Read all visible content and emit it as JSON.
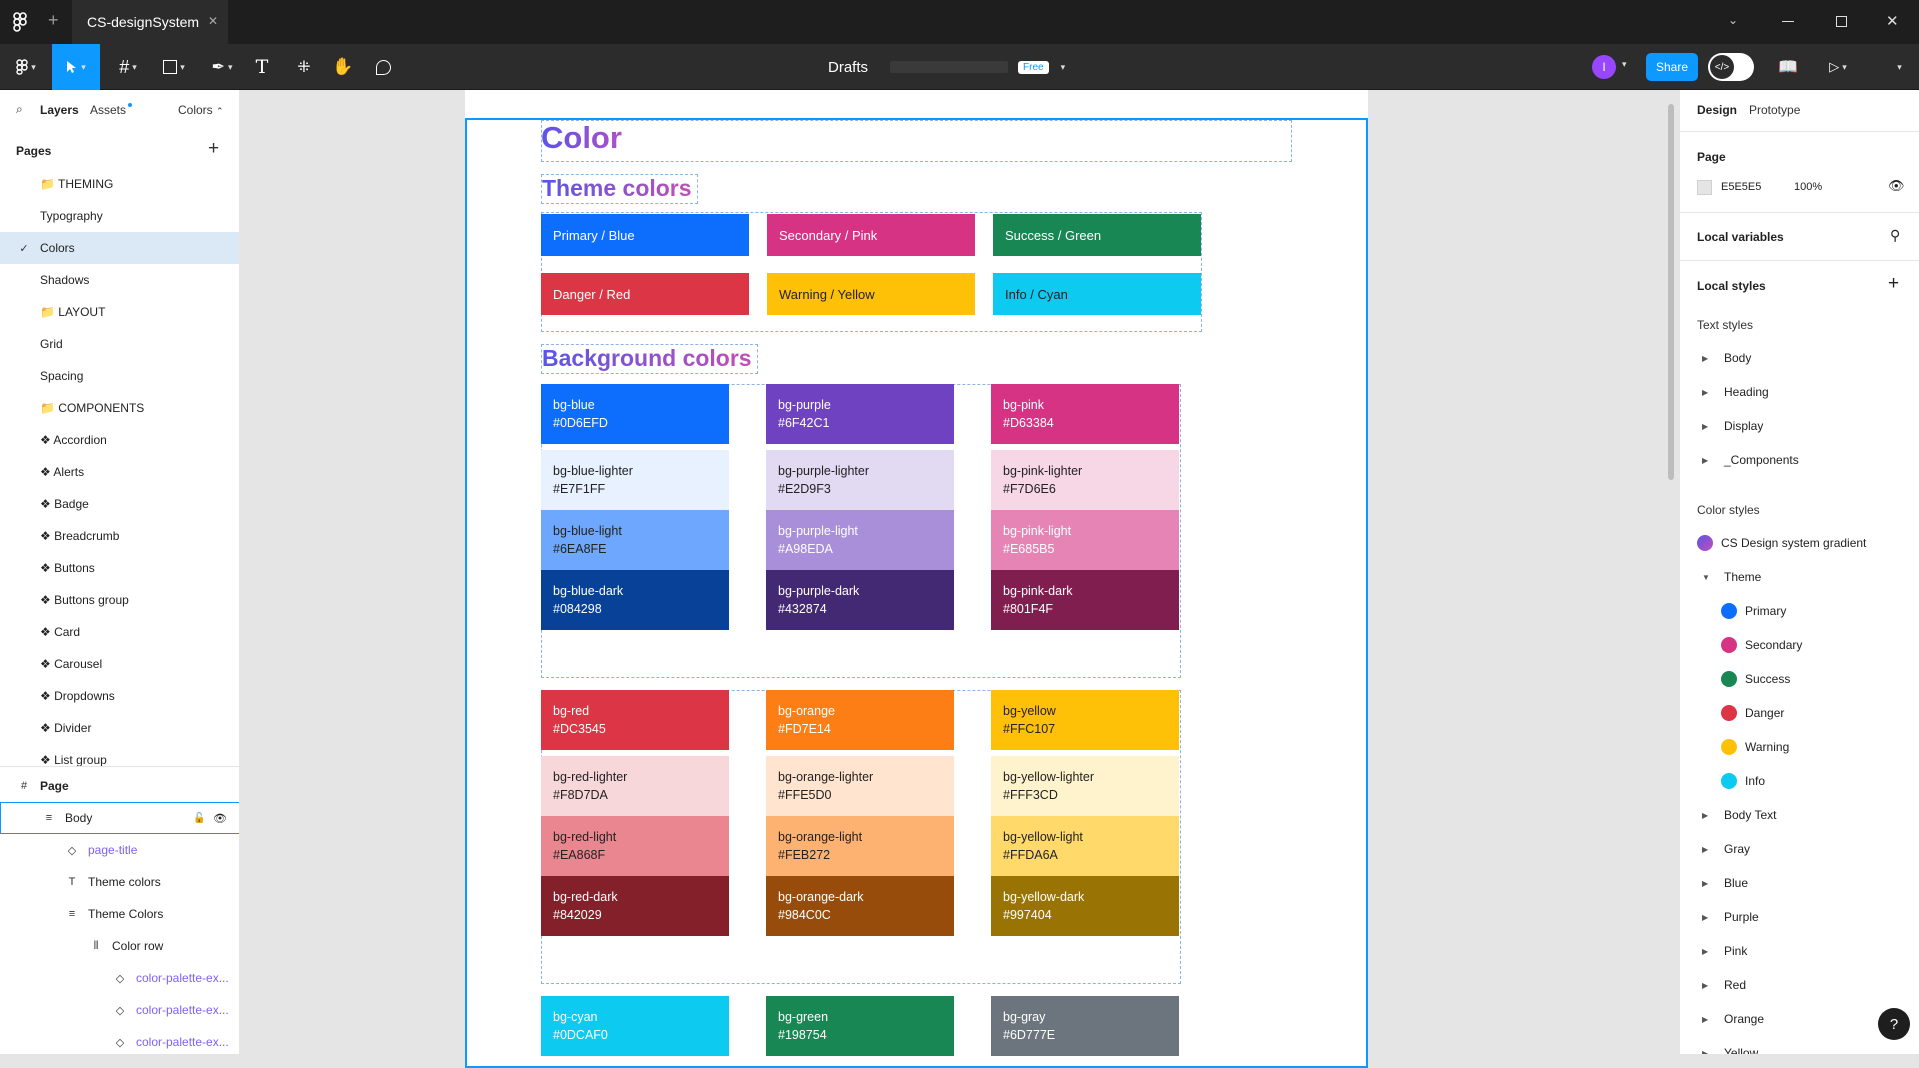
{
  "titlebar": {
    "file_tab": "CS-designSystem",
    "close_tab": "✕",
    "add_tab": "+"
  },
  "toolbar": {
    "breadcrumb_drafts": "Drafts",
    "plan_badge": "Free",
    "share_label": "Share",
    "avatar_initial": "I"
  },
  "left_panel": {
    "tab_layers": "Layers",
    "tab_assets": "Assets",
    "page_selector": "Colors",
    "pages_heading": "Pages",
    "pages": [
      {
        "label": "📁 THEMING",
        "icon": ""
      },
      {
        "label": "Typography",
        "icon": ""
      },
      {
        "label": "Colors",
        "icon": "✓"
      },
      {
        "label": "Shadows",
        "icon": ""
      },
      {
        "label": "📁 LAYOUT",
        "icon": ""
      },
      {
        "label": "Grid",
        "icon": ""
      },
      {
        "label": "Spacing",
        "icon": ""
      },
      {
        "label": "📁 COMPONENTS",
        "icon": ""
      },
      {
        "label": "❖ Accordion",
        "icon": ""
      },
      {
        "label": "❖ Alerts",
        "icon": ""
      },
      {
        "label": "❖ Badge",
        "icon": ""
      },
      {
        "label": "❖ Breadcrumb",
        "icon": ""
      },
      {
        "label": "❖ Buttons",
        "icon": ""
      },
      {
        "label": "❖ Buttons group",
        "icon": ""
      },
      {
        "label": "❖ Card",
        "icon": ""
      },
      {
        "label": "❖ Carousel",
        "icon": ""
      },
      {
        "label": "❖ Dropdowns",
        "icon": ""
      },
      {
        "label": "❖ Divider",
        "icon": ""
      },
      {
        "label": "❖ List group",
        "icon": ""
      }
    ],
    "layers": [
      {
        "label": "Page",
        "icon": "#",
        "indent": 0
      },
      {
        "label": "Body",
        "icon": "≡",
        "indent": 1
      },
      {
        "label": "page-title",
        "icon": "◇",
        "indent": 2
      },
      {
        "label": "Theme colors",
        "icon": "T",
        "indent": 2
      },
      {
        "label": "Theme Colors",
        "icon": "≡",
        "indent": 2
      },
      {
        "label": "Color row",
        "icon": "⦀",
        "indent": 3
      },
      {
        "label": "color-palette-ex...",
        "icon": "◇",
        "indent": 4
      },
      {
        "label": "color-palette-ex...",
        "icon": "◇",
        "indent": 4
      },
      {
        "label": "color-palette-ex...",
        "icon": "◇",
        "indent": 4
      }
    ]
  },
  "canvas": {
    "heading_color": "Color",
    "heading_theme": "Theme colors",
    "heading_background": "Background colors",
    "theme_swatches": [
      {
        "label": "Primary / Blue",
        "color": "#0d6efd",
        "text": "#fff"
      },
      {
        "label": "Secondary / Pink",
        "color": "#d63384",
        "text": "#fff"
      },
      {
        "label": "Success / Green",
        "color": "#198754",
        "text": "#fff"
      },
      {
        "label": "Danger / Red",
        "color": "#dc3545",
        "text": "#fff"
      },
      {
        "label": "Warning / Yellow",
        "color": "#ffc107",
        "text": "#222"
      },
      {
        "label": "Info / Cyan",
        "color": "#0dcaf0",
        "text": "#222"
      }
    ],
    "bg_groups": [
      [
        [
          {
            "name": "bg-blue",
            "hex": "#0D6EFD",
            "color": "#0d6efd",
            "text": "#fff"
          },
          {
            "name": "bg-blue-lighter",
            "hex": "#E7F1FF",
            "color": "#e7f1ff",
            "text": "#222"
          },
          {
            "name": "bg-blue-light",
            "hex": "#6EA8FE",
            "color": "#6ea8fe",
            "text": "#222"
          },
          {
            "name": "bg-blue-dark",
            "hex": "#084298",
            "color": "#084298",
            "text": "#fff"
          }
        ],
        [
          {
            "name": "bg-purple",
            "hex": "#6F42C1",
            "color": "#6f42c1",
            "text": "#fff"
          },
          {
            "name": "bg-purple-lighter",
            "hex": "#E2D9F3",
            "color": "#e2d9f3",
            "text": "#222"
          },
          {
            "name": "bg-purple-light",
            "hex": "#A98EDA",
            "color": "#a98eda",
            "text": "#fff"
          },
          {
            "name": "bg-purple-dark",
            "hex": "#432874",
            "color": "#432874",
            "text": "#fff"
          }
        ],
        [
          {
            "name": "bg-pink",
            "hex": "#D63384",
            "color": "#d63384",
            "text": "#fff"
          },
          {
            "name": "bg-pink-lighter",
            "hex": "#F7D6E6",
            "color": "#f7d6e6",
            "text": "#222"
          },
          {
            "name": "bg-pink-light",
            "hex": "#E685B5",
            "color": "#e685b5",
            "text": "#fff"
          },
          {
            "name": "bg-pink-dark",
            "hex": "#801F4F",
            "color": "#801f4f",
            "text": "#fff"
          }
        ]
      ],
      [
        [
          {
            "name": "bg-red",
            "hex": "#DC3545",
            "color": "#dc3545",
            "text": "#fff"
          },
          {
            "name": "bg-red-lighter",
            "hex": "#F8D7DA",
            "color": "#f8d7da",
            "text": "#222"
          },
          {
            "name": "bg-red-light",
            "hex": "#EA868F",
            "color": "#ea868f",
            "text": "#222"
          },
          {
            "name": "bg-red-dark",
            "hex": "#842029",
            "color": "#842029",
            "text": "#fff"
          }
        ],
        [
          {
            "name": "bg-orange",
            "hex": "#FD7E14",
            "color": "#fd7e14",
            "text": "#fff"
          },
          {
            "name": "bg-orange-lighter",
            "hex": "#FFE5D0",
            "color": "#ffe5d0",
            "text": "#222"
          },
          {
            "name": "bg-orange-light",
            "hex": "#FEB272",
            "color": "#feb272",
            "text": "#222"
          },
          {
            "name": "bg-orange-dark",
            "hex": "#984C0C",
            "color": "#984c0c",
            "text": "#fff"
          }
        ],
        [
          {
            "name": "bg-yellow",
            "hex": "#FFC107",
            "color": "#ffc107",
            "text": "#222"
          },
          {
            "name": "bg-yellow-lighter",
            "hex": "#FFF3CD",
            "color": "#fff3cd",
            "text": "#222"
          },
          {
            "name": "bg-yellow-light",
            "hex": "#FFDA6A",
            "color": "#ffda6a",
            "text": "#222"
          },
          {
            "name": "bg-yellow-dark",
            "hex": "#997404",
            "color": "#997404",
            "text": "#fff"
          }
        ]
      ],
      [
        [
          {
            "name": "bg-cyan",
            "hex": "#0DCAF0",
            "color": "#0dcaf0",
            "text": "#fff"
          }
        ],
        [
          {
            "name": "bg-green",
            "hex": "#198754",
            "color": "#198754",
            "text": "#fff"
          }
        ],
        [
          {
            "name": "bg-gray",
            "hex": "#6D777E",
            "color": "#6c757d",
            "text": "#fff"
          }
        ]
      ]
    ]
  },
  "right_panel": {
    "tab_design": "Design",
    "tab_prototype": "Prototype",
    "page_heading": "Page",
    "page_color": "E5E5E5",
    "page_opacity": "100%",
    "local_variables": "Local variables",
    "local_styles": "Local styles",
    "text_styles_heading": "Text styles",
    "text_styles": [
      "Body",
      "Heading",
      "Display",
      "_Components"
    ],
    "color_styles_heading": "Color styles",
    "gradient_style": "CS Design system gradient",
    "theme_group": "Theme",
    "theme_styles": [
      {
        "label": "Primary",
        "color": "#0d6efd"
      },
      {
        "label": "Secondary",
        "color": "#d63384"
      },
      {
        "label": "Success",
        "color": "#198754"
      },
      {
        "label": "Danger",
        "color": "#dc3545"
      },
      {
        "label": "Warning",
        "color": "#ffc107"
      },
      {
        "label": "Info",
        "color": "#0dcaf0"
      }
    ],
    "collapsed_groups": [
      "Body Text",
      "Gray",
      "Blue",
      "Purple",
      "Pink",
      "Red",
      "Orange",
      "Yellow"
    ],
    "help": "?"
  }
}
